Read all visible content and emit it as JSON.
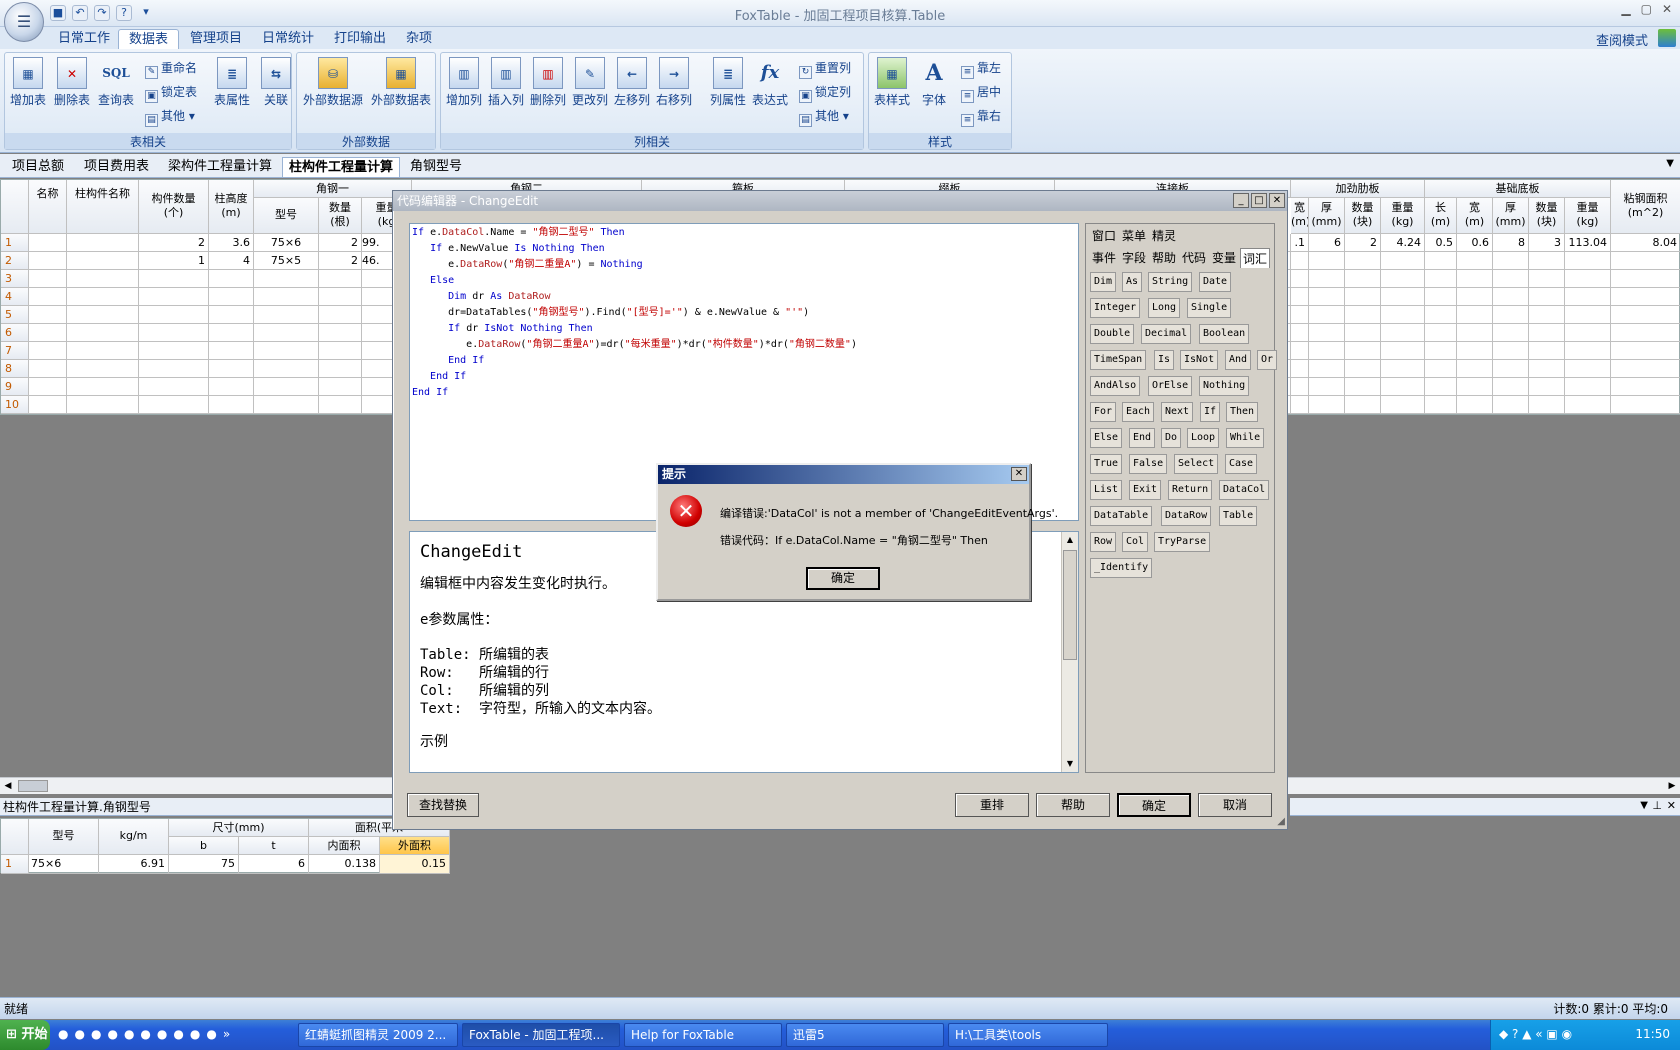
{
  "app": {
    "title": "FoxTable - 加固工程项目核算.Table",
    "view_mode": "查阅模式"
  },
  "ribbon_tabs": [
    "日常工作",
    "数据表",
    "管理项目",
    "日常统计",
    "打印输出",
    "杂项"
  ],
  "ribbon": {
    "table_group": {
      "label": "表相关",
      "add_table": "增加表",
      "delete_table": "删除表",
      "query_table": "查询表",
      "query_icon_text": "SQL",
      "rename": "重命名",
      "lock_table": "锁定表",
      "other": "其他",
      "table_props": "表属性",
      "relation": "关联"
    },
    "external_group": {
      "label": "外部数据",
      "ext_source": "外部数据源",
      "ext_table": "外部数据表"
    },
    "column_group": {
      "label": "列相关",
      "add_col": "增加列",
      "insert_col": "插入列",
      "delete_col": "删除列",
      "change_col": "更改列",
      "move_left": "左移列",
      "move_right": "右移列",
      "col_props": "列属性",
      "expression": "表达式",
      "expression_icon_text": "fx",
      "reset_col": "重置列",
      "lock_col": "锁定列",
      "other": "其他"
    },
    "style_group": {
      "label": "样式",
      "table_style": "表样式",
      "font": "字体",
      "font_icon_text": "A",
      "align_left": "靠左",
      "align_center": "居中",
      "align_right": "靠右"
    }
  },
  "doc_tabs": [
    "项目总额",
    "项目费用表",
    "梁构件工程量计算",
    "柱构件工程量计算",
    "角钢型号"
  ],
  "main_grid": {
    "headers": {
      "name": "名称",
      "col_name": "柱构件名称",
      "count": "构件数量\n(个)",
      "height": "柱高度\n(m)",
      "angle1": "角钢一",
      "angle2": "角钢二",
      "hoop": "箍板",
      "pad": "缀板",
      "connector": "连接板",
      "rib": "加劲肋板",
      "base": "基础底板",
      "area": "粘钢面积\n(m^2)",
      "type": "型号",
      "qty": "数量\n(根)",
      "weight": "重量\n(kg",
      "w": "宽\n(m)",
      "t": "厚\n(mm)",
      "qtyb": "数量\n(块)",
      "wkg": "重量\n(kg)",
      "l": "长\n(m)"
    },
    "rows": [
      {
        "n": "1",
        "count": "2",
        "height": "3.6",
        "type": "75×6",
        "qty": "2",
        "weight": "99.",
        "rib_w": ".1",
        "rib_t": "6",
        "rib_q": "2",
        "rib_kg": "4.24",
        "base_l": "0.5",
        "base_w": "0.6",
        "base_t": "8",
        "base_q": "3",
        "base_kg": "113.04",
        "area": "8.04"
      },
      {
        "n": "2",
        "count": "1",
        "height": "4",
        "type": "75×5",
        "qty": "2",
        "weight": "46."
      },
      {
        "n": "3"
      },
      {
        "n": "4"
      },
      {
        "n": "5"
      },
      {
        "n": "6"
      },
      {
        "n": "7"
      },
      {
        "n": "8"
      },
      {
        "n": "9"
      },
      {
        "n": "10"
      }
    ]
  },
  "bottom_grid": {
    "caption": "柱构件工程量计算.角钢型号",
    "headers": {
      "type": "型号",
      "kgm": "kg/m",
      "size": "尺寸(mm)",
      "b": "b",
      "t": "t",
      "area": "面积(平米",
      "inner": "内面积",
      "outer": "外面积"
    },
    "rows": [
      {
        "n": "1",
        "type": "75×6",
        "kgm": "6.91",
        "b": "75",
        "t": "6",
        "inner": "0.138",
        "outer": "0.15"
      }
    ]
  },
  "editor": {
    "title": "代码编辑器 - ChangeEdit",
    "code": [
      [
        [
          "kw",
          "If "
        ],
        [
          "",
          "e."
        ],
        [
          "mem",
          "DataCol"
        ],
        [
          "",
          ".Name = "
        ],
        [
          "str",
          "\"角钢二型号\""
        ],
        [
          "kw",
          " Then"
        ]
      ],
      [
        [
          "",
          "   "
        ],
        [
          "kw",
          "If "
        ],
        [
          "",
          "e.NewValue "
        ],
        [
          "kw",
          "Is Nothing Then"
        ]
      ],
      [
        [
          "",
          "      e."
        ],
        [
          "mem",
          "DataRow"
        ],
        [
          "",
          "("
        ],
        [
          "str",
          "\"角钢二重量A\""
        ],
        [
          "",
          ") = "
        ],
        [
          "kw",
          "Nothing"
        ]
      ],
      [
        [
          "kw",
          "   Else"
        ]
      ],
      [
        [
          "",
          "      "
        ],
        [
          "kw",
          "Dim "
        ],
        [
          "",
          "dr "
        ],
        [
          "kw",
          "As "
        ],
        [
          "mem",
          "DataRow"
        ]
      ],
      [
        [
          "",
          "      dr=DataTables("
        ],
        [
          "str",
          "\"角钢型号\""
        ],
        [
          "",
          ").Find("
        ],
        [
          "str",
          "\"[型号]='\""
        ],
        [
          "",
          ") & e.NewValue & "
        ],
        [
          "str",
          "\"'\""
        ],
        [
          "",
          ")"
        ]
      ],
      [
        [
          "",
          "      "
        ],
        [
          "kw",
          "If "
        ],
        [
          "",
          "dr "
        ],
        [
          "kw",
          "IsNot Nothing Then"
        ]
      ],
      [
        [
          "",
          "         e."
        ],
        [
          "mem",
          "DataRow"
        ],
        [
          "",
          "("
        ],
        [
          "str",
          "\"角钢二重量A\""
        ],
        [
          "",
          ")=dr("
        ],
        [
          "str",
          "\"每米重量\""
        ],
        [
          "",
          ")*dr("
        ],
        [
          "str",
          "\"构件数量\""
        ],
        [
          "",
          ")*dr("
        ],
        [
          "str",
          "\"角钢二数量\""
        ],
        [
          "",
          ")"
        ]
      ],
      [
        [
          "kw",
          "      End If"
        ]
      ],
      [
        [
          "kw",
          "   End If"
        ]
      ],
      [
        [
          "kw",
          "End If"
        ]
      ]
    ],
    "help": {
      "heading": "ChangeEdit",
      "desc": "编辑框中内容发生变化时执行。",
      "params_title": "e参数属性：",
      "p1": "Table: 所编辑的表",
      "p2": "Row:   所编辑的行",
      "p3": "Col:   所编辑的列",
      "p4": "Text:  字符型，所输入的文本内容。",
      "example": "示例"
    },
    "pane_tabs_row1": [
      "窗口",
      "菜单",
      "精灵"
    ],
    "pane_tabs_row2": [
      "事件",
      "字段",
      "帮助",
      "代码",
      "变量",
      "词汇"
    ],
    "keywords": [
      [
        "Dim",
        "As",
        "String",
        "Date"
      ],
      [
        "Integer",
        "Long",
        "Single"
      ],
      [
        "Double",
        "Decimal",
        "Boolean"
      ],
      [
        "TimeSpan",
        "Is",
        "IsNot",
        "And",
        "Or"
      ],
      [
        "AndAlso",
        "OrElse",
        "Nothing"
      ],
      [
        "For",
        "Each",
        "Next",
        "If",
        "Then"
      ],
      [
        "Else",
        "End",
        "Do",
        "Loop",
        "While"
      ],
      [
        "True",
        "False",
        "Select",
        "Case"
      ],
      [
        "List",
        "Exit",
        "Return",
        "DataCol"
      ],
      [
        "DataTable",
        "DataRow",
        "Table"
      ],
      [
        "Row",
        "Col",
        "TryParse"
      ],
      [
        "_Identify"
      ]
    ],
    "buttons": {
      "find": "查找替换",
      "rearrange": "重排",
      "help": "帮助",
      "ok": "确定",
      "cancel": "取消"
    }
  },
  "msgbox": {
    "title": "提示",
    "line1": "编译错误:'DataCol' is not a member of 'ChangeEditEventArgs'.",
    "line2": "错误代码：If e.DataCol.Name = \"角钢二型号\" Then",
    "ok": "确定"
  },
  "status": {
    "left": "就绪",
    "right": "计数:0 累计:0 平均:0"
  },
  "taskbar": {
    "start": "开始",
    "items": [
      "红蜻蜓抓图精灵 2009 2...",
      "FoxTable - 加固工程项...",
      "Help for FoxTable",
      "迅雷5",
      "H:\\工具类\\tools"
    ],
    "clock": "11:50"
  }
}
